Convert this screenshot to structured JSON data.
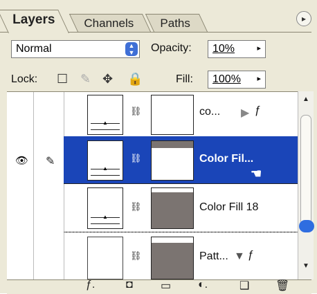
{
  "tabs": [
    {
      "label": "Layers",
      "active": true
    },
    {
      "label": "Channels",
      "active": false
    },
    {
      "label": "Paths",
      "active": false
    }
  ],
  "blend_mode": {
    "value": "Normal"
  },
  "opacity": {
    "label": "Opacity:",
    "value": "10%"
  },
  "lock": {
    "label": "Lock:"
  },
  "fill": {
    "label": "Fill:",
    "value": "100%"
  },
  "layers": [
    {
      "name": "co...",
      "selected": false,
      "has_fx": true,
      "fx_arrow": "▶",
      "mask_top_gray": false
    },
    {
      "name": "Color Fil...",
      "selected": true,
      "has_fx": false,
      "mask_top_gray": true
    },
    {
      "name": "Color Fill 18",
      "selected": false,
      "has_fx": false,
      "mask_top_gray": false
    },
    {
      "name": "Patt...",
      "selected": false,
      "has_fx": true,
      "fx_arrow": "▼",
      "mask_top_gray": false
    }
  ],
  "colors": {
    "selection": "#1a45b8",
    "panel_bg": "#ece9d8",
    "mask_gray": "#7b7471"
  }
}
